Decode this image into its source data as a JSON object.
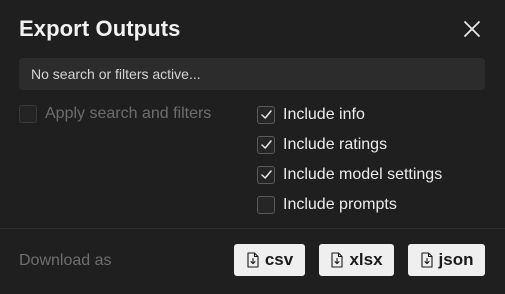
{
  "dialog": {
    "title": "Export Outputs",
    "close_icon": "close-icon"
  },
  "filter": {
    "text": "No search or filters active..."
  },
  "apply_filters": {
    "label": "Apply search and filters",
    "checked": false,
    "disabled": true
  },
  "options": [
    {
      "label": "Include info",
      "checked": true
    },
    {
      "label": "Include ratings",
      "checked": true
    },
    {
      "label": "Include model settings",
      "checked": true
    },
    {
      "label": "Include prompts",
      "checked": false
    }
  ],
  "footer": {
    "label": "Download as",
    "buttons": [
      {
        "label": "csv",
        "icon": "file-icon"
      },
      {
        "label": "xlsx",
        "icon": "file-icon"
      },
      {
        "label": "json",
        "icon": "file-icon"
      }
    ]
  },
  "colors": {
    "background": "#1f1f1f",
    "input_bg": "#2c2c2c",
    "button_bg": "#efefef"
  }
}
